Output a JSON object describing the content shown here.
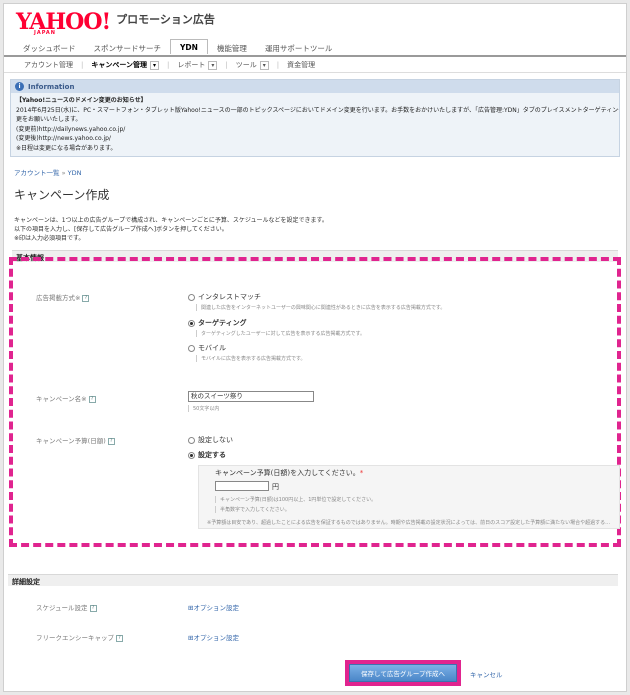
{
  "brand": {
    "logo": "YAHOO!",
    "logo_sub": "JAPAN",
    "product": "プロモーション広告"
  },
  "nav": {
    "tabs": [
      "ダッシュボード",
      "スポンサードサーチ",
      "YDN",
      "機能管理",
      "運用サポートツール"
    ],
    "subtabs": [
      "アカウント管理",
      "キャンペーン管理",
      "レポート",
      "ツール",
      "資金管理"
    ]
  },
  "info": {
    "title": "Information",
    "lines": [
      "【Yahoo!ニュースのドメイン変更のお知らせ】",
      "2014年6月25日(水)に、PC・スマートフォン・タブレット版Yahoo!ニュースの一部のトピックスページにおいてドメイン変更を行います。お手数をおかけいたしますが、「広告管理:YDN」タブのプレイスメントターゲティングで掲載…",
      "更をお願いいたします。",
      "(変更前)http://dailynews.yahoo.co.jp/",
      "(変更後)http://news.yahoo.co.jp/",
      "※日程は変更になる場合があります。"
    ]
  },
  "breadcrumb": {
    "root": "アカウント一覧",
    "sep": "»",
    "current": "YDN"
  },
  "page_title": "キャンペーン作成",
  "description": [
    "キャンペーンは、1つ以上の広告グループで構成され、キャンペーンごとに予算、スケジュールなどを設定できます。",
    "以下の項目を入力し、[保存して広告グループ作成へ]ボタンを押してください。",
    "※印は入力必須項目です。"
  ],
  "basic": {
    "heading": "基本情報",
    "delivery_label": "広告掲載方式※",
    "options": [
      {
        "label": "インタレストマッチ",
        "desc": "関連した広告をインターネットユーザーの興味関心に関連性があるときに広告を表示する広告掲載方式です。"
      },
      {
        "label": "ターゲティング",
        "desc": "ターゲティングしたユーザーに対して広告を表示する広告掲載方式です。"
      },
      {
        "label": "モバイル",
        "desc": "モバイルに広告を表示する広告掲載方式です。"
      }
    ],
    "name_label": "キャンペーン名※",
    "name_value": "秋のスイーツ祭り",
    "name_hint": "50文字以内",
    "budget_label": "キャンペーン予算(日額)",
    "budget_off": "設定しない",
    "budget_on": "設定する",
    "budget_prompt": "キャンペーン予算(日額)を入力してください。",
    "budget_required": "*",
    "budget_unit": "円",
    "budget_hint1": "キャンペーン予算(日額)は100円以上、1円単位で設定してください。",
    "budget_hint2": "半角数字で入力してください。",
    "budget_note": "※予算額は目安であり、超過したことによる広告を保証するものではありません。時期や広告掲載の設定状況によっては、前日のスコア設定した予算額に満たない場合や超過する…"
  },
  "detail": {
    "heading": "詳細設定",
    "schedule_label": "スケジュール設定",
    "schedule_link": "オプション設定",
    "freq_label": "フリークエンシーキャップ",
    "freq_link": "オプション設定"
  },
  "actions": {
    "save": "保存して広告グループ作成へ",
    "cancel": "キャンセル"
  },
  "colors": {
    "highlight": "#e0248f",
    "accent": "#ff0033"
  }
}
